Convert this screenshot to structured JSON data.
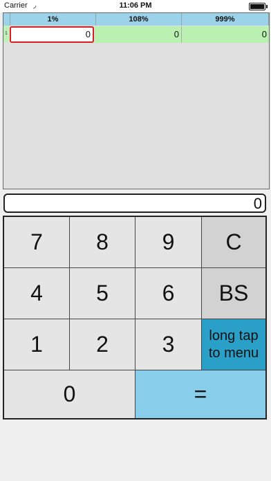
{
  "status_bar": {
    "carrier": "Carrier",
    "wifi_icon": "wifi-icon",
    "time": "11:06 PM"
  },
  "sheet": {
    "headers": [
      "1%",
      "108%",
      "999%"
    ],
    "row_label": "1",
    "cells": [
      "0",
      "0",
      "0"
    ]
  },
  "display": {
    "value": "0"
  },
  "keypad": {
    "k7": "7",
    "k8": "8",
    "k9": "9",
    "clear": "C",
    "k4": "4",
    "k5": "5",
    "k6": "6",
    "backspace": "BS",
    "k1": "1",
    "k2": "2",
    "k3": "3",
    "menu_line1": "long tap",
    "menu_line2": "to menu",
    "k0": "0",
    "equals": "="
  },
  "colors": {
    "header_bg": "#9cd3ea",
    "row_bg": "#baf0b0",
    "active_border": "#d62020",
    "menu_key": "#2aa0c8",
    "equals_key": "#88cdea"
  }
}
